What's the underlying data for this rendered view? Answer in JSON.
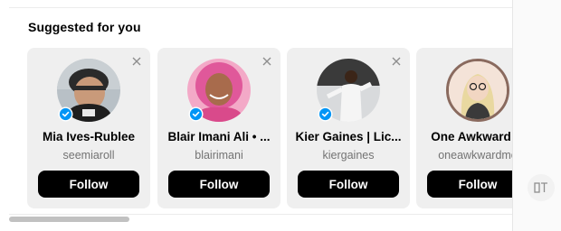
{
  "section": {
    "title": "Suggested for you"
  },
  "suggestions": [
    {
      "name": "Mia Ives-Rublee",
      "username": "seemiaroll",
      "follow_label": "Follow",
      "verified": true
    },
    {
      "name": "Blair Imani Ali • ...",
      "username": "blairimani",
      "follow_label": "Follow",
      "verified": true
    },
    {
      "name": "Kier Gaines | Lic...",
      "username": "kiergaines",
      "follow_label": "Follow",
      "verified": true
    },
    {
      "name": "One Awkward ...",
      "username": "oneawkwardmo",
      "follow_label": "Follow",
      "verified": false
    }
  ],
  "colors": {
    "follow_bg": "#000000",
    "verified": "#0095f6",
    "card_bg": "#efefef",
    "muted_text": "#737373"
  },
  "icons": {
    "dismiss": "close-icon",
    "verified": "verified-badge-icon",
    "side": "translate-icon"
  }
}
